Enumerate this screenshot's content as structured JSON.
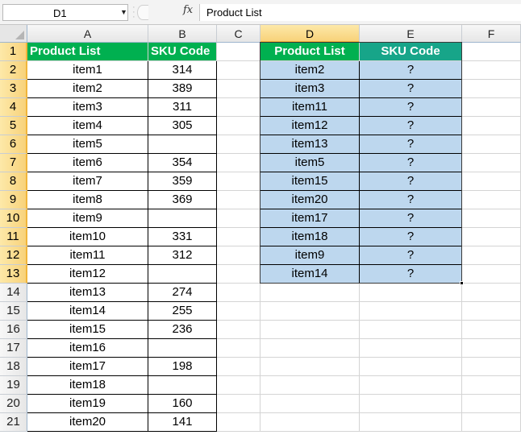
{
  "formula_bar": {
    "name_box": "D1",
    "fx_label": "fx",
    "formula": "Product List"
  },
  "columns": [
    "A",
    "B",
    "C",
    "D",
    "E",
    "F"
  ],
  "rows": [
    "1",
    "2",
    "3",
    "4",
    "5",
    "6",
    "7",
    "8",
    "9",
    "10",
    "11",
    "12",
    "13",
    "14",
    "15",
    "16",
    "17",
    "18",
    "19",
    "20",
    "21"
  ],
  "source_table": {
    "header_product": "Product List",
    "header_sku": "SKU Code",
    "items": [
      {
        "product": "item1",
        "sku": "314"
      },
      {
        "product": "item2",
        "sku": "389"
      },
      {
        "product": "item3",
        "sku": "311"
      },
      {
        "product": "item4",
        "sku": "305"
      },
      {
        "product": "item5",
        "sku": ""
      },
      {
        "product": "item6",
        "sku": "354"
      },
      {
        "product": "item7",
        "sku": "359"
      },
      {
        "product": "item8",
        "sku": "369"
      },
      {
        "product": "item9",
        "sku": ""
      },
      {
        "product": "item10",
        "sku": "331"
      },
      {
        "product": "item11",
        "sku": "312"
      },
      {
        "product": "item12",
        "sku": ""
      },
      {
        "product": "item13",
        "sku": "274"
      },
      {
        "product": "item14",
        "sku": "255"
      },
      {
        "product": "item15",
        "sku": "236"
      },
      {
        "product": "item16",
        "sku": ""
      },
      {
        "product": "item17",
        "sku": "198"
      },
      {
        "product": "item18",
        "sku": ""
      },
      {
        "product": "item19",
        "sku": "160"
      },
      {
        "product": "item20",
        "sku": "141"
      }
    ]
  },
  "lookup_table": {
    "header_product": "Product List",
    "header_sku": "SKU Code",
    "items": [
      {
        "product": "item2",
        "sku": "?"
      },
      {
        "product": "item3",
        "sku": "?"
      },
      {
        "product": "item11",
        "sku": "?"
      },
      {
        "product": "item12",
        "sku": "?"
      },
      {
        "product": "item13",
        "sku": "?"
      },
      {
        "product": "item5",
        "sku": "?"
      },
      {
        "product": "item15",
        "sku": "?"
      },
      {
        "product": "item20",
        "sku": "?"
      },
      {
        "product": "item17",
        "sku": "?"
      },
      {
        "product": "item18",
        "sku": "?"
      },
      {
        "product": "item9",
        "sku": "?"
      },
      {
        "product": "item14",
        "sku": "?"
      }
    ]
  },
  "colors": {
    "header_green": "#00b050",
    "header_teal": "#17a589",
    "lookup_fill": "#bdd7ee",
    "selected_header": "#f8d27a"
  }
}
